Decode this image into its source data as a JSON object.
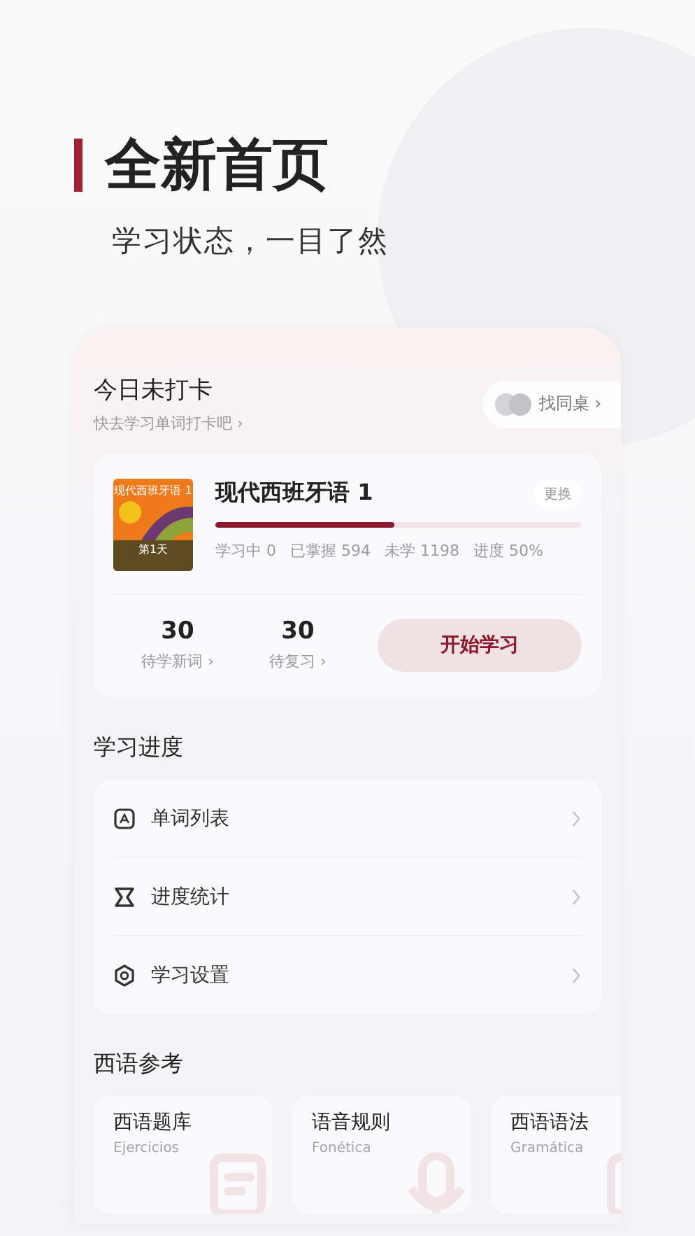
{
  "hero": {
    "title": "全新首页",
    "subtitle": "学习状态，一目了然"
  },
  "checkin": {
    "title": "今日未打卡",
    "subtitle": "快去学习单词打卡吧 ›",
    "deskmate_button": "找同桌 ›"
  },
  "book": {
    "cover_title": "现代西班牙语 1",
    "cover_day": "第1天",
    "title": "现代西班牙语 1",
    "change_button": "更换",
    "progress": {
      "level": 0.49
    },
    "stats": [
      "学习中 0",
      "已掌握 594",
      "未学 1198",
      "进度 50%"
    ],
    "counts": [
      {
        "value": "30",
        "label": "待学新词 ›"
      },
      {
        "value": "30",
        "label": "待复习 ›"
      }
    ],
    "start_button": "开始学习"
  },
  "progress_section": {
    "title": "学习进度",
    "items": [
      {
        "kind": "word-list",
        "label": "单词列表"
      },
      {
        "kind": "stats",
        "label": "进度统计"
      },
      {
        "kind": "settings",
        "label": "学习设置"
      }
    ]
  },
  "reference_section": {
    "title": "西语参考",
    "cards": [
      {
        "kind": "exercises",
        "title": "西语题库",
        "subtitle": "Ejercicios"
      },
      {
        "kind": "phonetics",
        "title": "语音规则",
        "subtitle": "Fonética"
      },
      {
        "kind": "grammar",
        "title": "西语语法",
        "subtitle": "Gramática"
      }
    ]
  }
}
